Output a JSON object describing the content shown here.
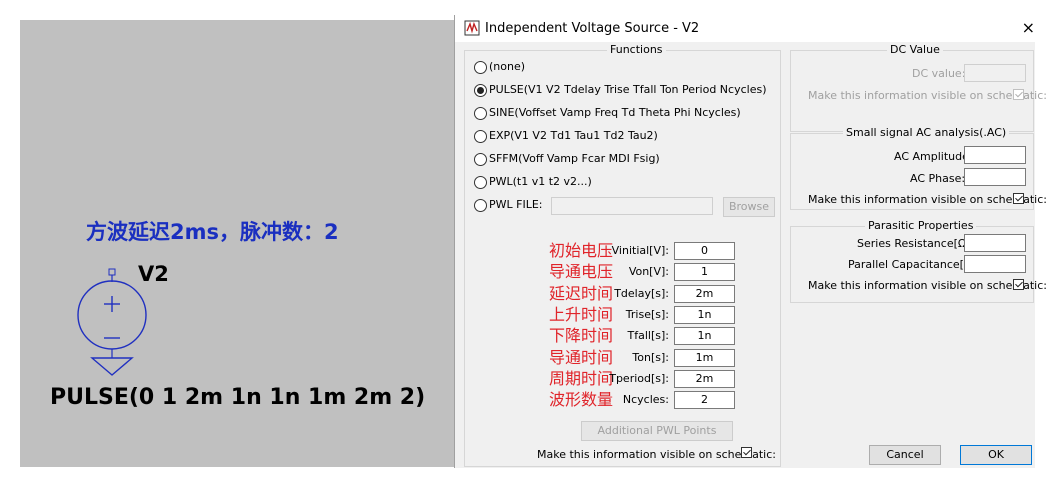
{
  "schematic": {
    "note": "方波延迟2ms，脉冲数：2",
    "component_name": "V2",
    "value_text": "PULSE(0 1 2m 1n 1n 1m 2m 2)"
  },
  "dialog": {
    "title": "Independent Voltage Source - V2",
    "close_glyph": "×",
    "functions": {
      "title": "Functions",
      "options": [
        {
          "label": "(none)",
          "checked": false
        },
        {
          "label": "PULSE(V1 V2 Tdelay Trise Tfall Ton Period Ncycles)",
          "checked": true
        },
        {
          "label": "SINE(Voffset Vamp Freq Td Theta Phi Ncycles)",
          "checked": false
        },
        {
          "label": "EXP(V1 V2 Td1 Tau1 Td2 Tau2)",
          "checked": false
        },
        {
          "label": "SFFM(Voff Vamp Fcar MDI Fsig)",
          "checked": false
        },
        {
          "label": "PWL(t1 v1 t2 v2...)",
          "checked": false
        },
        {
          "label": "PWL FILE:",
          "checked": false
        }
      ],
      "browse_label": "Browse",
      "params": [
        {
          "annotation": "初始电压",
          "label": "Vinitial[V]:",
          "value": "0"
        },
        {
          "annotation": "导通电压",
          "label": "Von[V]:",
          "value": "1"
        },
        {
          "annotation": "延迟时间",
          "label": "Tdelay[s]:",
          "value": "2m"
        },
        {
          "annotation": "上升时间",
          "label": "Trise[s]:",
          "value": "1n"
        },
        {
          "annotation": "下降时间",
          "label": "Tfall[s]:",
          "value": "1n"
        },
        {
          "annotation": "导通时间",
          "label": "Ton[s]:",
          "value": "1m"
        },
        {
          "annotation": "周期时间",
          "label": "Tperiod[s]:",
          "value": "2m"
        },
        {
          "annotation": "波形数量",
          "label": "Ncycles:",
          "value": "2"
        }
      ],
      "additional_pwl_label": "Additional PWL Points",
      "visible_label": "Make this information visible on schematic:"
    },
    "dc": {
      "title": "DC Value",
      "dc_value_label": "DC value:",
      "visible_label": "Make this information visible on schematic:"
    },
    "ac": {
      "title": "Small signal AC analysis(.AC)",
      "amplitude_label": "AC Amplitude:",
      "phase_label": "AC Phase:",
      "visible_label": "Make this information visible on schematic:"
    },
    "parasitic": {
      "title": "Parasitic Properties",
      "series_label": "Series Resistance[Ω]:",
      "parallel_label": "Parallel Capacitance[F]:",
      "visible_label": "Make this information visible on schematic:"
    },
    "buttons": {
      "cancel": "Cancel",
      "ok": "OK"
    }
  }
}
